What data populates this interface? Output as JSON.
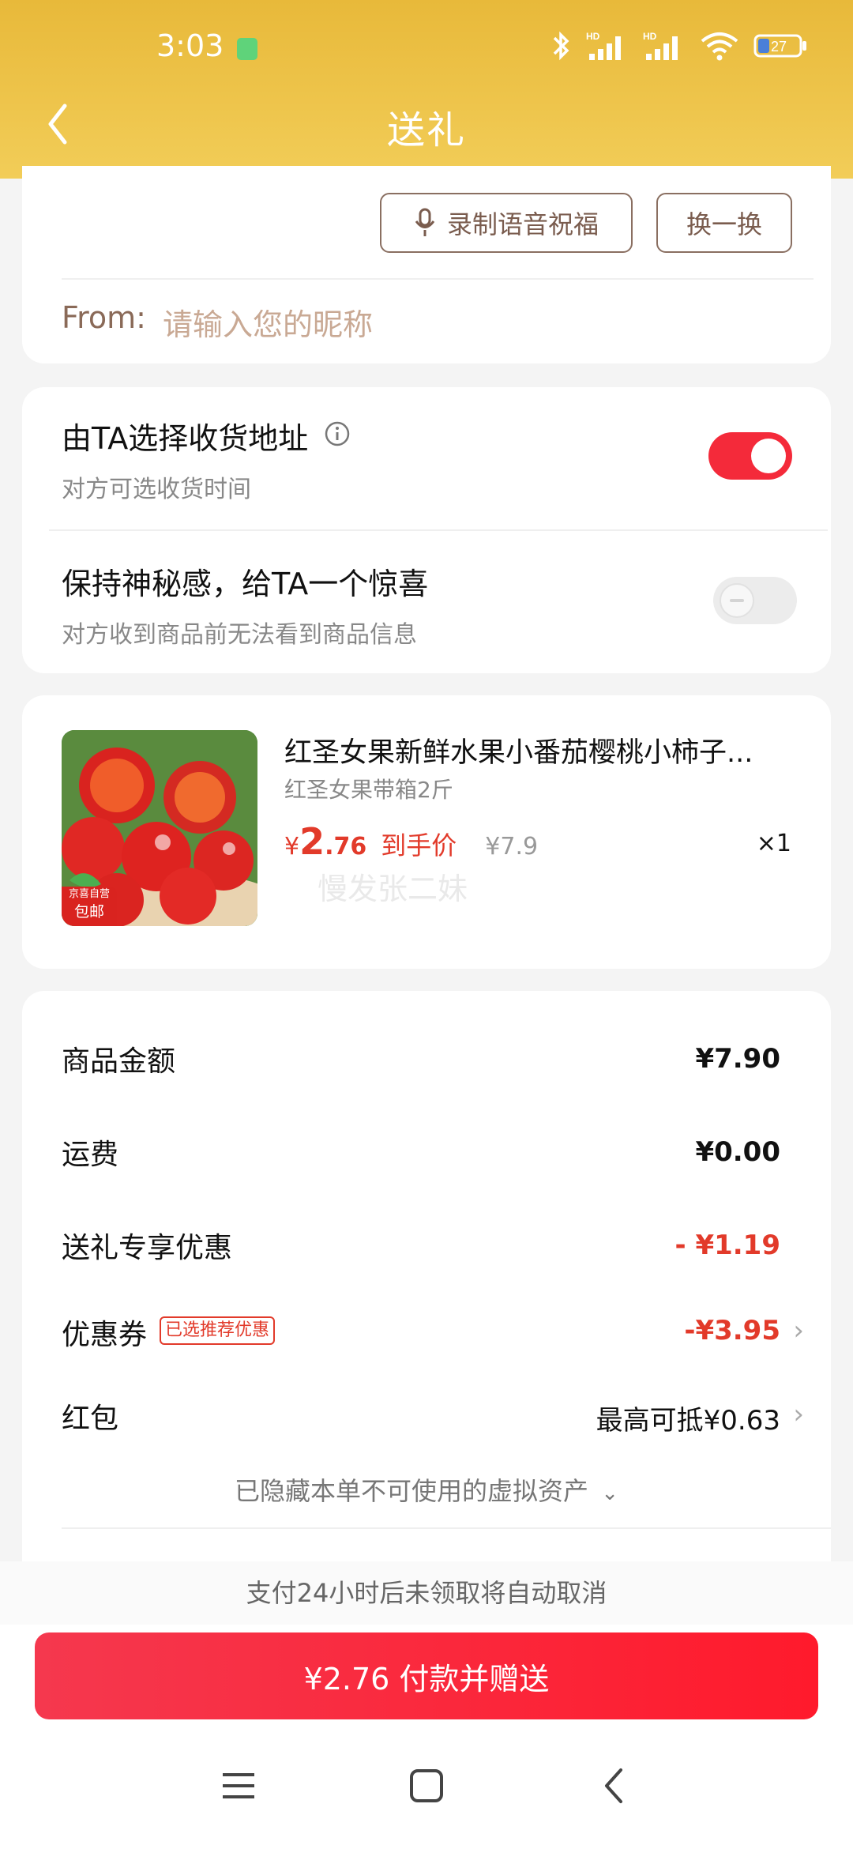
{
  "status_bar": {
    "time": "3:03",
    "battery": "27"
  },
  "nav": {
    "title": "送礼"
  },
  "greeting_card": {
    "record_voice_label": "录制语音祝福",
    "swap_label": "换一换",
    "from_label": "From:",
    "nickname_placeholder": "请输入您的昵称"
  },
  "options": {
    "recipient_address": {
      "title": "由TA选择收货地址",
      "subtitle": "对方可选收货时间",
      "enabled": true
    },
    "mystery": {
      "title": "保持神秘感，给TA一个惊喜",
      "subtitle": "对方收到商品前无法看到商品信息",
      "enabled": false
    }
  },
  "product": {
    "name": "红圣女果新鲜水果小番茄樱桃小柿子...",
    "spec": "红圣女果带箱2斤",
    "price_symbol": "¥",
    "price_int": "2",
    "price_dec": ".76",
    "price_tag": "到手价",
    "original_price": "¥7.9",
    "quantity": "×1",
    "image_badge_top": "京喜自营",
    "image_badge_bottom": "包邮",
    "watermark": "慢发张二妹"
  },
  "summary": {
    "items": [
      {
        "label": "商品金额",
        "value": "¥7.90",
        "color": "#111111"
      },
      {
        "label": "运费",
        "value": "¥0.00",
        "color": "#111111"
      },
      {
        "label": "送礼专享优惠",
        "value": "- ¥1.19",
        "color": "#e23a2a"
      },
      {
        "label": "优惠券",
        "tag": "已选推荐优惠",
        "value": "-¥3.95",
        "color": "#e23a2a"
      },
      {
        "label": "红包",
        "value": "最高可抵¥0.63",
        "color": "#111111"
      }
    ],
    "hidden_assets": "已隐藏本单不可使用的虚拟资产"
  },
  "footer": {
    "notice": "支付24小时后未领取将自动取消",
    "pay_button": "¥2.76 付款并赠送"
  }
}
